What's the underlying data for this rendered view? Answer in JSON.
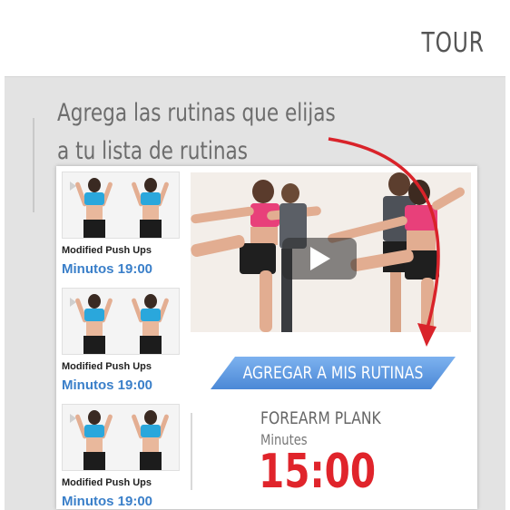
{
  "header": {
    "tour_label": "TOUR"
  },
  "intro": {
    "line1": "Agrega las rutinas que elijas",
    "line2": "a tu lista de rutinas"
  },
  "routines": [
    {
      "name": "Modified Push Ups",
      "duration": "Minutos 19:00"
    },
    {
      "name": "Modified Push Ups",
      "duration": "Minutos 19:00"
    },
    {
      "name": "Modified Push Ups",
      "duration": "Minutos 19:00"
    }
  ],
  "player": {
    "add_button_label": "AGREGAR A MIS RUTINAS"
  },
  "exercise": {
    "name": "FOREARM PLANK",
    "unit": "Minutes",
    "time": "15:00"
  },
  "icons": {
    "play": "play-icon",
    "arrow": "curved-arrow-icon"
  },
  "colors": {
    "accent_red": "#e0242b",
    "accent_blue": "#3a7fc9",
    "button_blue": "#5a95de"
  }
}
